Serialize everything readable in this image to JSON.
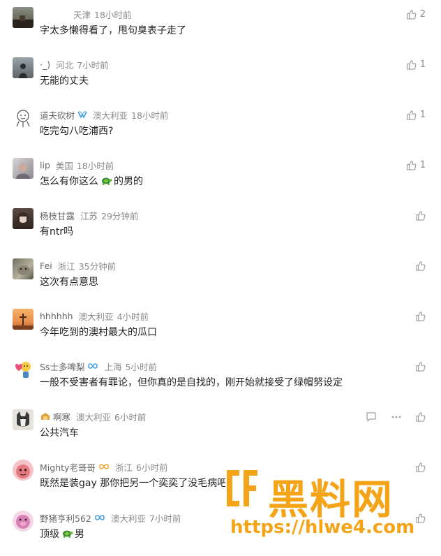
{
  "comments": [
    {
      "user": "",
      "location": "天津",
      "time": "18小时前",
      "text": "字太多懒得看了，甩句臭表子走了",
      "likes": "2"
    },
    {
      "user": "·_)",
      "location": "河北",
      "time": "7小时前",
      "text": "无能的丈夫",
      "likes": "1"
    },
    {
      "user": "道夫砍树",
      "location": "澳大利亚",
      "time": "18小时前",
      "text": "吃完勾八吃浦西?",
      "likes": "1"
    },
    {
      "user": "lip",
      "location": "美国",
      "time": "18小时前",
      "text_a": "怎么有你这么",
      "text_b": "的男的",
      "likes": "1"
    },
    {
      "user": "杨枝甘露",
      "location": "江苏",
      "time": "29分钟前",
      "text": "有ntr吗",
      "likes": ""
    },
    {
      "user": "Fei",
      "location": "浙江",
      "time": "35分钟前",
      "text": "这次有点意思",
      "likes": ""
    },
    {
      "user": "hhhhhh",
      "location": "澳大利亚",
      "time": "4小时前",
      "text": "今年吃到的澳村最大的瓜口",
      "likes": ""
    },
    {
      "user": "Ss士多啤梨",
      "location": "上海",
      "time": "5小时前",
      "text": "一般不受害者有罪论，但你真的是自找的，刚开始就接受了绿帽努设定",
      "likes": ""
    },
    {
      "user": "啊寒",
      "location": "澳大利亚",
      "time": "6小时前",
      "text": "公共汽车",
      "likes": ""
    },
    {
      "user": "Mighty老哥哥",
      "location": "浙江",
      "time": "6小时前",
      "text": "既然是装gay 那你把另一个奕奕了没毛病吧",
      "likes": ""
    },
    {
      "user": "野猪亨利562",
      "location": "澳大利亚",
      "time": "7小时前",
      "text_a": "顶级",
      "text_b": "男",
      "likes": ""
    }
  ],
  "watermark": {
    "title": "黑料网",
    "url": "https://hlwe4.com"
  },
  "icons": {
    "like": "thumbs-up-icon",
    "reply": "comment-icon",
    "more": "more-icon"
  },
  "colors": {
    "meta": "#8a8a8a",
    "text": "#222222",
    "badge": "#4aa3df",
    "watermark": "#f5a417"
  }
}
